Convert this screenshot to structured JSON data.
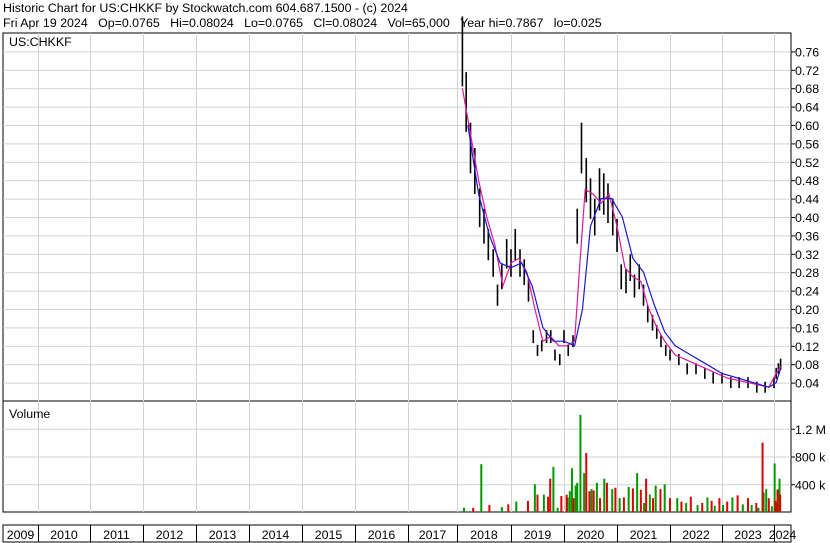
{
  "header": {
    "title": "Historic Chart for US:CHKKF by Stockwatch.com 604.687.1500 - (c) 2024",
    "date": "Fri Apr 19 2024",
    "open": "Op=0.0765",
    "high": "Hi=0.08024",
    "low": "Lo=0.0765",
    "close": "Cl=0.08024",
    "volume": "Vol=65,000",
    "year_high": "Year hi=0.7867",
    "year_low": "lo=0.025"
  },
  "chart_data": [
    {
      "type": "line",
      "title": "US:CHKKF",
      "ylim": [
        0.0,
        0.8
      ],
      "yticks": [
        0.04,
        0.08,
        0.12,
        0.16,
        0.2,
        0.24,
        0.28,
        0.32,
        0.36,
        0.4,
        0.44,
        0.48,
        0.52,
        0.56,
        0.6,
        0.64,
        0.68,
        0.72,
        0.76
      ],
      "ytick_labels": [
        "0.04",
        "0.08",
        "0.12",
        "0.16",
        "0.20",
        "0.24",
        "0.28",
        "0.32",
        "0.36",
        "0.40",
        "0.44",
        "0.48",
        "0.52",
        "0.56",
        "0.60",
        "0.64",
        "0.68",
        "0.72",
        "0.76"
      ],
      "grid": true,
      "x_years": [
        "2009",
        "2010",
        "2011",
        "2012",
        "2013",
        "2014",
        "2015",
        "2016",
        "2017",
        "2018",
        "2019",
        "2020",
        "2021",
        "2022",
        "2023",
        "2024"
      ],
      "series": [
        {
          "style": "price-bars",
          "color": "#000000",
          "x": [
            2018.1,
            2018.17,
            2018.25,
            2018.33,
            2018.42,
            2018.5,
            2018.58,
            2018.67,
            2018.75,
            2018.83,
            2018.92,
            2019.0,
            2019.08,
            2019.17,
            2019.25,
            2019.33,
            2019.42,
            2019.5,
            2019.58,
            2019.67,
            2019.75,
            2019.83,
            2019.92,
            2020.0,
            2020.08,
            2020.17,
            2020.25,
            2020.33,
            2020.42,
            2020.5,
            2020.58,
            2020.67,
            2020.75,
            2020.83,
            2020.92,
            2021.0,
            2021.08,
            2021.17,
            2021.25,
            2021.33,
            2021.42,
            2021.5,
            2021.58,
            2021.67,
            2021.75,
            2021.83,
            2021.92,
            2022.0,
            2022.17,
            2022.33,
            2022.5,
            2022.67,
            2022.83,
            2023.0,
            2023.17,
            2023.33,
            2023.5,
            2023.67,
            2023.83,
            2024.0,
            2024.1,
            2024.2,
            2024.3
          ],
          "close": [
            0.76,
            0.65,
            0.55,
            0.5,
            0.42,
            0.38,
            0.34,
            0.3,
            0.23,
            0.27,
            0.32,
            0.3,
            0.34,
            0.3,
            0.28,
            0.24,
            0.14,
            0.11,
            0.12,
            0.14,
            0.14,
            0.1,
            0.09,
            0.14,
            0.11,
            0.13,
            0.38,
            0.55,
            0.48,
            0.44,
            0.4,
            0.46,
            0.45,
            0.43,
            0.4,
            0.36,
            0.27,
            0.26,
            0.29,
            0.25,
            0.27,
            0.23,
            0.19,
            0.17,
            0.15,
            0.13,
            0.11,
            0.1,
            0.09,
            0.07,
            0.07,
            0.06,
            0.05,
            0.05,
            0.04,
            0.04,
            0.04,
            0.03,
            0.03,
            0.04,
            0.06,
            0.07,
            0.08
          ]
        },
        {
          "style": "moving-average",
          "color": "#e0189c",
          "x": [
            2018.1,
            2018.25,
            2018.4,
            2018.55,
            2018.7,
            2018.85,
            2019.0,
            2019.15,
            2019.3,
            2019.45,
            2019.6,
            2019.75,
            2019.9,
            2020.05,
            2020.2,
            2020.3,
            2020.4,
            2020.55,
            2020.7,
            2020.85,
            2021.0,
            2021.15,
            2021.3,
            2021.45,
            2021.6,
            2021.75,
            2021.9,
            2022.1,
            2022.3,
            2022.5,
            2022.7,
            2022.9,
            2023.1,
            2023.3,
            2023.5,
            2023.7,
            2023.9,
            2024.1,
            2024.3
          ],
          "values": [
            0.68,
            0.58,
            0.48,
            0.4,
            0.34,
            0.25,
            0.3,
            0.31,
            0.28,
            0.2,
            0.13,
            0.14,
            0.12,
            0.12,
            0.13,
            0.3,
            0.46,
            0.45,
            0.43,
            0.45,
            0.38,
            0.29,
            0.27,
            0.26,
            0.2,
            0.16,
            0.13,
            0.1,
            0.09,
            0.08,
            0.07,
            0.06,
            0.05,
            0.045,
            0.04,
            0.035,
            0.03,
            0.06,
            0.075
          ]
        },
        {
          "style": "moving-average",
          "color": "#1a1ad0",
          "x": [
            2018.2,
            2018.4,
            2018.6,
            2018.8,
            2019.0,
            2019.2,
            2019.4,
            2019.6,
            2019.8,
            2020.0,
            2020.2,
            2020.35,
            2020.5,
            2020.7,
            2020.9,
            2021.1,
            2021.3,
            2021.5,
            2021.7,
            2021.9,
            2022.1,
            2022.4,
            2022.7,
            2023.0,
            2023.3,
            2023.6,
            2023.9,
            2024.1,
            2024.3
          ],
          "values": [
            0.6,
            0.45,
            0.36,
            0.3,
            0.29,
            0.3,
            0.25,
            0.16,
            0.13,
            0.13,
            0.12,
            0.2,
            0.38,
            0.44,
            0.44,
            0.4,
            0.31,
            0.28,
            0.21,
            0.15,
            0.12,
            0.1,
            0.08,
            0.06,
            0.05,
            0.04,
            0.03,
            0.04,
            0.07
          ]
        }
      ]
    },
    {
      "type": "bar",
      "title": "Volume",
      "ylim": [
        0,
        1600000
      ],
      "yticks": [
        400000,
        800000,
        1200000
      ],
      "ytick_labels": [
        "400 k",
        "800 k",
        "1.2 M"
      ],
      "grid": true,
      "x_years": [
        "2009",
        "2010",
        "2011",
        "2012",
        "2013",
        "2014",
        "2015",
        "2016",
        "2017",
        "2018",
        "2019",
        "2020",
        "2021",
        "2022",
        "2023",
        "2024"
      ],
      "series": [
        {
          "color": "#009900",
          "x": [
            2018.13,
            2018.45,
            2018.83,
            2019.1,
            2019.45,
            2019.62,
            2019.8,
            2019.88,
            2020.07,
            2020.11,
            2020.15,
            2020.22,
            2020.25,
            2020.31,
            2020.38,
            2020.52,
            2020.62,
            2020.76,
            2020.91,
            2021.05,
            2021.22,
            2021.38,
            2021.51,
            2021.62,
            2021.73,
            2021.9,
            2022.14,
            2022.31,
            2022.53,
            2022.72,
            2022.86,
            2023.02,
            2023.2,
            2023.4,
            2023.57,
            2023.7,
            2023.8,
            2023.85,
            2023.96,
            2024.03,
            2024.12,
            2024.2,
            2024.25
          ],
          "values": [
            60000,
            690000,
            70000,
            150000,
            400000,
            250000,
            650000,
            60000,
            210000,
            300000,
            630000,
            380000,
            420000,
            1400000,
            560000,
            330000,
            420000,
            480000,
            330000,
            200000,
            360000,
            560000,
            130000,
            250000,
            380000,
            400000,
            200000,
            130000,
            100000,
            210000,
            90000,
            100000,
            210000,
            110000,
            100000,
            60000,
            280000,
            330000,
            80000,
            700000,
            140000,
            330000,
            480000
          ]
        },
        {
          "color": "#dd0000",
          "x": [
            2018.3,
            2018.6,
            2018.95,
            2019.32,
            2019.5,
            2019.7,
            2019.74,
            2019.95,
            2020.05,
            2020.18,
            2020.42,
            2020.48,
            2020.56,
            2020.68,
            2020.81,
            2020.97,
            2021.13,
            2021.3,
            2021.45,
            2021.55,
            2021.68,
            2021.82,
            2022.0,
            2022.22,
            2022.4,
            2022.62,
            2022.8,
            2022.95,
            2023.1,
            2023.3,
            2023.5,
            2023.66,
            2023.78,
            2023.9,
            2024.06,
            2024.16,
            2024.28
          ],
          "values": [
            60000,
            100000,
            110000,
            160000,
            250000,
            220000,
            480000,
            230000,
            250000,
            200000,
            850000,
            300000,
            310000,
            200000,
            420000,
            350000,
            210000,
            340000,
            320000,
            480000,
            200000,
            330000,
            200000,
            150000,
            220000,
            130000,
            160000,
            200000,
            150000,
            240000,
            200000,
            130000,
            1000000,
            200000,
            160000,
            320000,
            250000
          ]
        }
      ]
    }
  ]
}
